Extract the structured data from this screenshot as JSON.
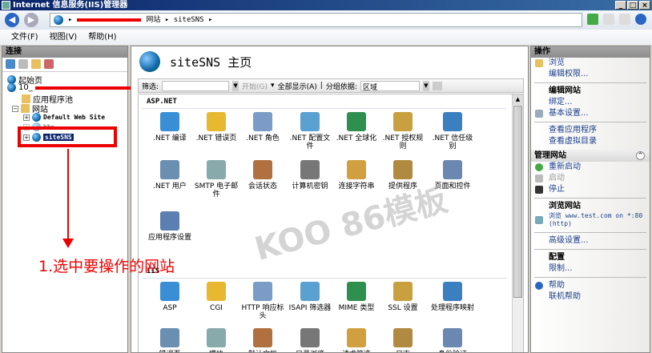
{
  "window": {
    "title": "Internet 信息服务(IIS)管理器"
  },
  "address": {
    "segments": [
      "网站",
      "siteSNS"
    ],
    "sep": "▸"
  },
  "menu": [
    "文件(F)",
    "视图(V)",
    "帮助(H)"
  ],
  "connections": {
    "title": "连接",
    "tree": {
      "start": "起始页",
      "server": "10_",
      "apppools": "应用程序池",
      "sites": "网站",
      "default_site": "Default Web Site",
      "other": "bbs",
      "selected": "siteSNS"
    }
  },
  "annotation": "1.选中要操作的网站",
  "watermark": "KOO 86模板",
  "center": {
    "title": "siteSNS 主页",
    "filter_label": "筛选:",
    "start_label": "开始(G)",
    "show_all": "全部显示(A)",
    "group_label": "分组依据:",
    "group_value": "区域",
    "sections": [
      {
        "name": "ASP.NET",
        "items": [
          ".NET 编译",
          ".NET 错误页",
          ".NET 角色",
          ".NET 配置文件",
          ".NET 全球化",
          ".NET 授权规则",
          ".NET 信任级别",
          ".NET 用户",
          "SMTP 电子邮件",
          "会话状态",
          "计算机密钥",
          "连接字符串",
          "提供程序",
          "页面和控件",
          "应用程序设置"
        ]
      },
      {
        "name": "IIS",
        "items": [
          "ASP",
          "CGI",
          "HTTP 响应标头",
          "ISAPI 筛选器",
          "MIME 类型",
          "SSL 设置",
          "处理程序映射",
          "错误页",
          "模块",
          "默认文档",
          "目录浏览",
          "请求筛选",
          "日志",
          "身份验证"
        ]
      }
    ]
  },
  "actions": {
    "title": "操作",
    "browse": "浏览",
    "edit_perms": "编辑权限...",
    "edit_site": "编辑网站",
    "bindings": "绑定...",
    "basic": "基本设置...",
    "view_apps": "查看应用程序",
    "view_vdirs": "查看虚拟目录",
    "manage": "管理网站",
    "restart": "重新启动",
    "start": "启动",
    "stop": "停止",
    "browse_site": "浏览网站",
    "browse_url": "浏览 www.test.com on *:80 (http)",
    "advanced": "高级设置...",
    "config": "配置",
    "limits": "限制...",
    "help": "帮助",
    "online_help": "联机帮助"
  },
  "icon_colors": [
    "#3a8ed6",
    "#e8b830",
    "#7a9cc6",
    "#5aa0d0",
    "#2f8f4f",
    "#c9a040",
    "#3a7fc0",
    "#6a8fb0",
    "#8aa",
    "#b07040",
    "#777",
    "#d0a040",
    "#b08a40",
    "#6a88b0",
    "#5a7fb0"
  ]
}
